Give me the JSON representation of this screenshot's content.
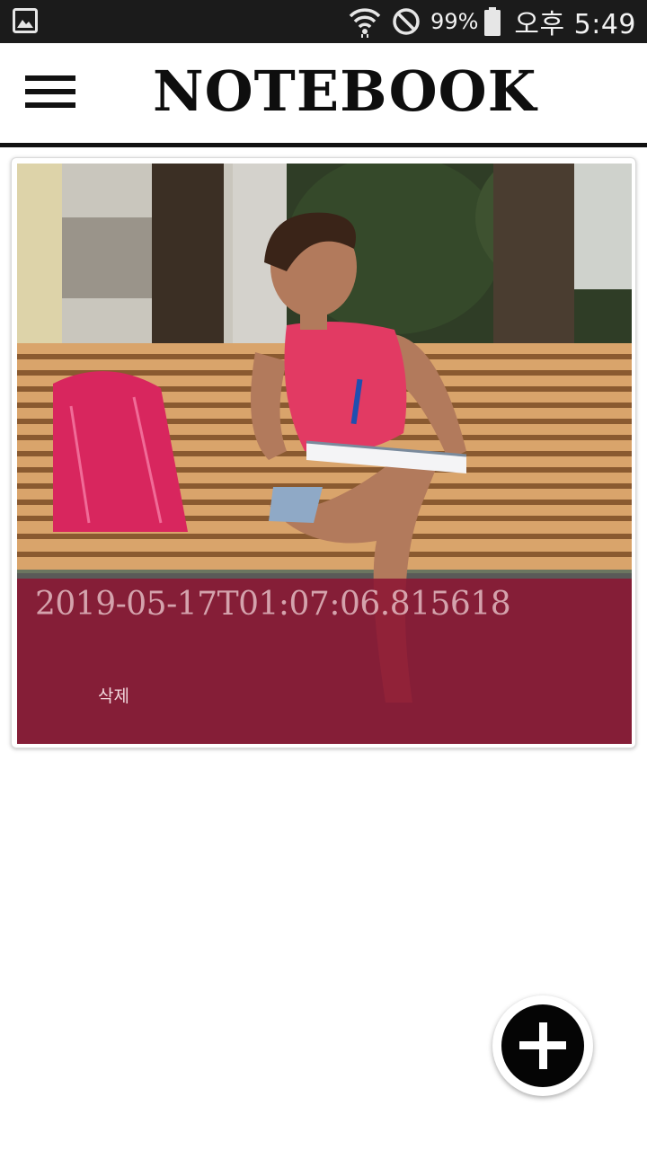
{
  "status_bar": {
    "battery_percent": "99%",
    "time": "오후 5:49",
    "icons": [
      "gallery-notification-icon",
      "wifi-icon",
      "do-not-disturb-icon",
      "battery-icon"
    ]
  },
  "app_bar": {
    "title": "NOTEBOOK",
    "menu_icon": "hamburger-menu-icon"
  },
  "notes": [
    {
      "timestamp": "2019-05-17T01:07:06.815618",
      "delete_label": "삭제",
      "image_description_icon": "note-photo"
    }
  ],
  "fab": {
    "icon": "plus-icon"
  },
  "colors": {
    "status_bar": "#1b1b1b",
    "overlay": "#8c1432",
    "fab": "#050505",
    "divider": "#111111"
  }
}
